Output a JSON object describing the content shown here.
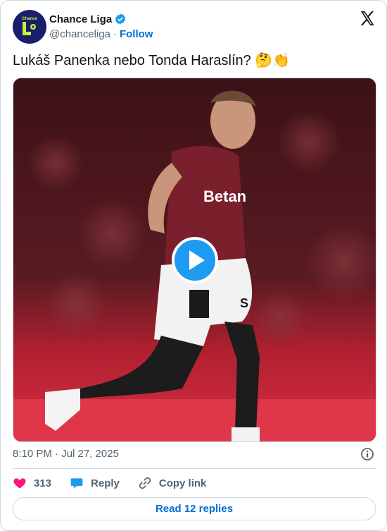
{
  "account": {
    "avatar_text": "Chance",
    "display_name": "Chance Liga",
    "handle": "@chanceliga",
    "separator": "·",
    "follow_label": "Follow"
  },
  "tweet": {
    "text": "Lukáš Panenka nebo Tonda Haraslín? 🤔👏",
    "timestamp": "8:10 PM · Jul 27, 2025"
  },
  "actions": {
    "likes": "313",
    "reply_label": "Reply",
    "copy_label": "Copy link",
    "read_replies": "Read 12 replies"
  },
  "colors": {
    "link_blue": "#006fd6",
    "like_pink": "#f91880",
    "reply_blue": "#1d9bf0",
    "avatar_bg": "#1a1f6b",
    "avatar_accent": "#c8f23a"
  },
  "media": {
    "alt": "video thumbnail: football player in maroon jersey celebrating on pitch",
    "jersey_text": "Betan",
    "shorts_text": "S"
  }
}
